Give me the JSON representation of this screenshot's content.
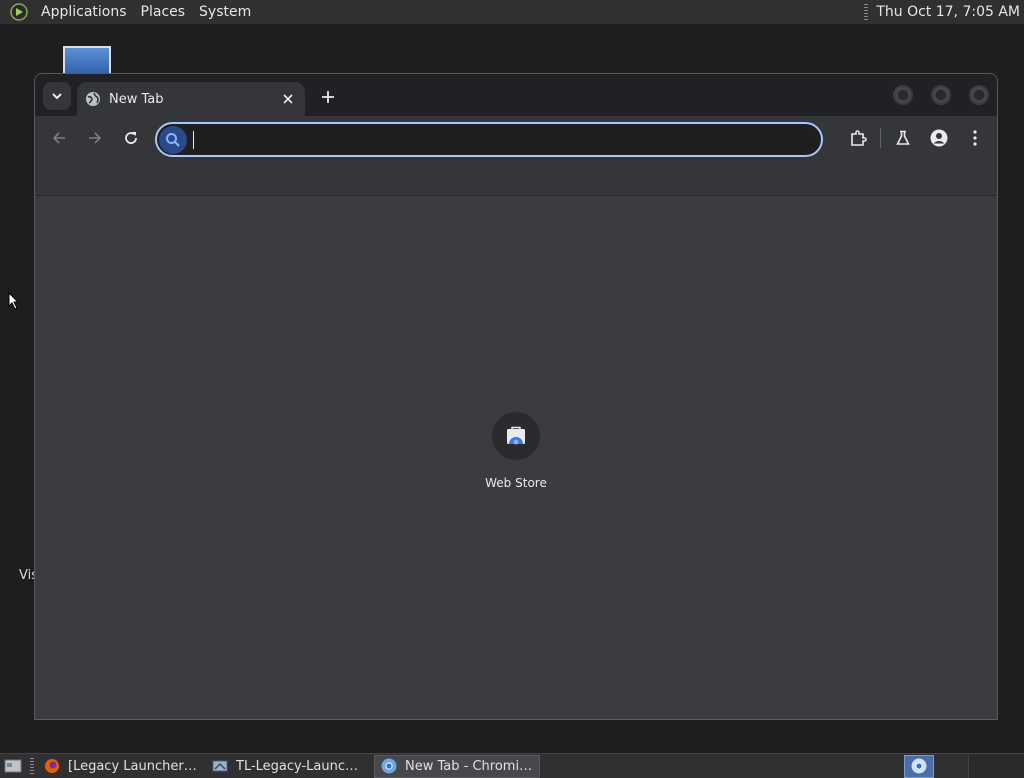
{
  "top_panel": {
    "menus": [
      "Applications",
      "Places",
      "System"
    ],
    "clock": "Thu Oct 17,  7:05 AM"
  },
  "desktop": {
    "partial_label": "Vis"
  },
  "browser": {
    "tab": {
      "title": "New Tab"
    },
    "omnibox": {
      "value": "",
      "placeholder": ""
    },
    "shortcuts": [
      {
        "label": "Web Store"
      }
    ]
  },
  "taskbar": {
    "tasks": [
      {
        "label": "[Legacy Launcher fo...",
        "active": false
      },
      {
        "label": "TL-Legacy-Launche...",
        "active": false
      },
      {
        "label": "New Tab - Chromium",
        "active": true
      }
    ]
  },
  "colors": {
    "accent": "#a8c7fa",
    "tab_active": "#35363a",
    "page_bg": "#3c3c40"
  },
  "icons": [
    "mint-menu-icon",
    "globe-icon",
    "close-icon",
    "plus-icon",
    "back-arrow-icon",
    "forward-arrow-icon",
    "reload-icon",
    "search-icon",
    "extensions-icon",
    "labs-flask-icon",
    "profile-icon",
    "kebab-menu-icon",
    "web-store-icon",
    "firefox-icon",
    "launcher-icon",
    "chromium-icon"
  ]
}
